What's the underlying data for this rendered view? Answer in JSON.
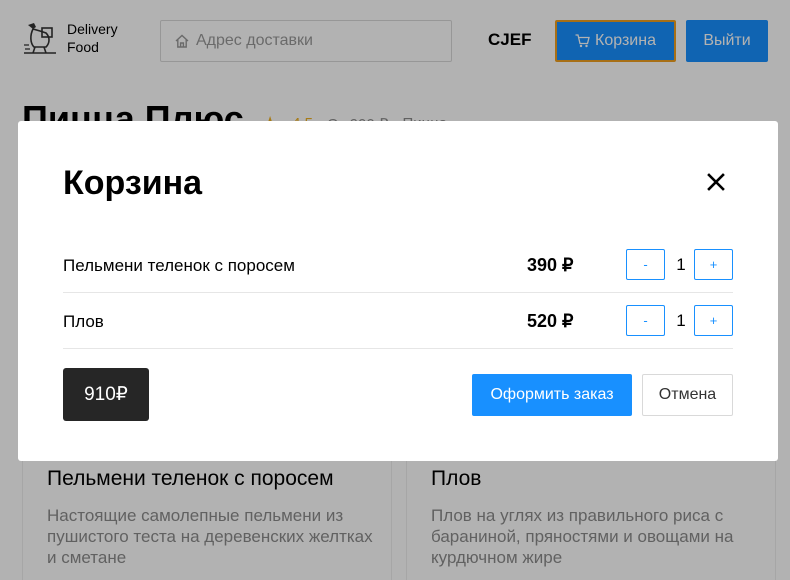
{
  "header": {
    "logo_text_line1": "Delivery",
    "logo_text_line2": "Food",
    "address_placeholder": "Адрес доставки",
    "user_name": "CJEF",
    "cart_label": "Корзина",
    "logout_label": "Выйти"
  },
  "restaurant": {
    "title": "Пицца Плюс",
    "rating": "4.5",
    "min_price": "От 900 ₽",
    "category": "Пицца"
  },
  "cards": [
    {
      "title": "Пельмени теленок с поросем",
      "description": "Настоящие самолепные пельмени из пушистого теста на деревенских желтках и сметане"
    },
    {
      "title": "Плов",
      "description": "Плов на углях из правильного риса с бараниной, пряностями и овощами на курдючном жире"
    }
  ],
  "modal": {
    "title": "Корзина",
    "items": [
      {
        "name": "Пельмени теленок с поросем",
        "price": "390 ₽",
        "qty": "1",
        "minus": "-",
        "plus": "+"
      },
      {
        "name": "Плов",
        "price": "520 ₽",
        "qty": "1",
        "minus": "-",
        "plus": "+"
      }
    ],
    "total": "910₽",
    "order_label": "Оформить заказ",
    "cancel_label": "Отмена"
  },
  "colors": {
    "accent": "#1890ff",
    "focus_border": "#f0a020",
    "total_bg": "#262626",
    "overlay": "rgba(0,0,0,0.3)"
  }
}
